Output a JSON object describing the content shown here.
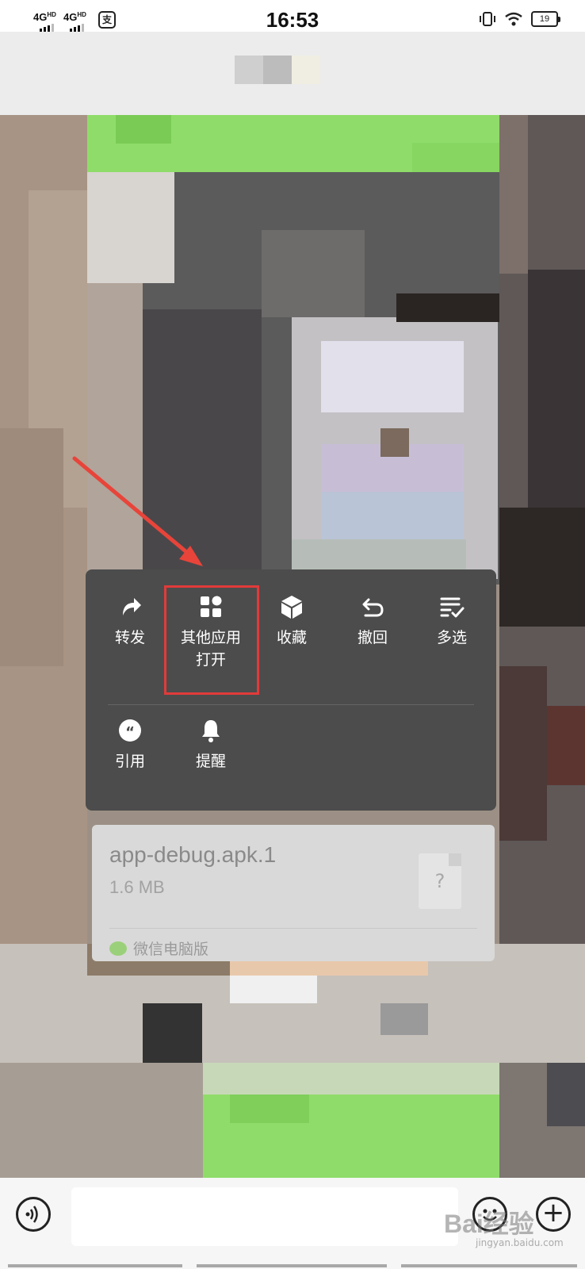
{
  "status_bar": {
    "sim1": "4G",
    "sim1_hd": "HD",
    "sim2": "4G",
    "sim2_hd": "HD",
    "time": "16:53",
    "battery": "19"
  },
  "context_menu": {
    "items_row1": [
      {
        "label": "转发",
        "icon": "forward-icon"
      },
      {
        "label": "其他应用\n打开",
        "icon": "grid-apps-icon"
      },
      {
        "label": "收藏",
        "icon": "cube-icon"
      },
      {
        "label": "撤回",
        "icon": "undo-icon"
      },
      {
        "label": "多选",
        "icon": "multi-select-icon"
      }
    ],
    "items_row2": [
      {
        "label": "引用",
        "icon": "quote-icon"
      },
      {
        "label": "提醒",
        "icon": "bell-icon"
      }
    ]
  },
  "file_message": {
    "file_name": "app-debug.apk.1",
    "file_size": "1.6 MB",
    "file_type_glyph": "?",
    "source": "微信电脑版"
  },
  "watermark": {
    "text": "Bai经验",
    "sub": "jingyan.baidu.com"
  },
  "colors": {
    "highlight": "#e23a3a",
    "menu_bg": "#4c4c4c",
    "bubble_green": "#8fdc6a"
  }
}
